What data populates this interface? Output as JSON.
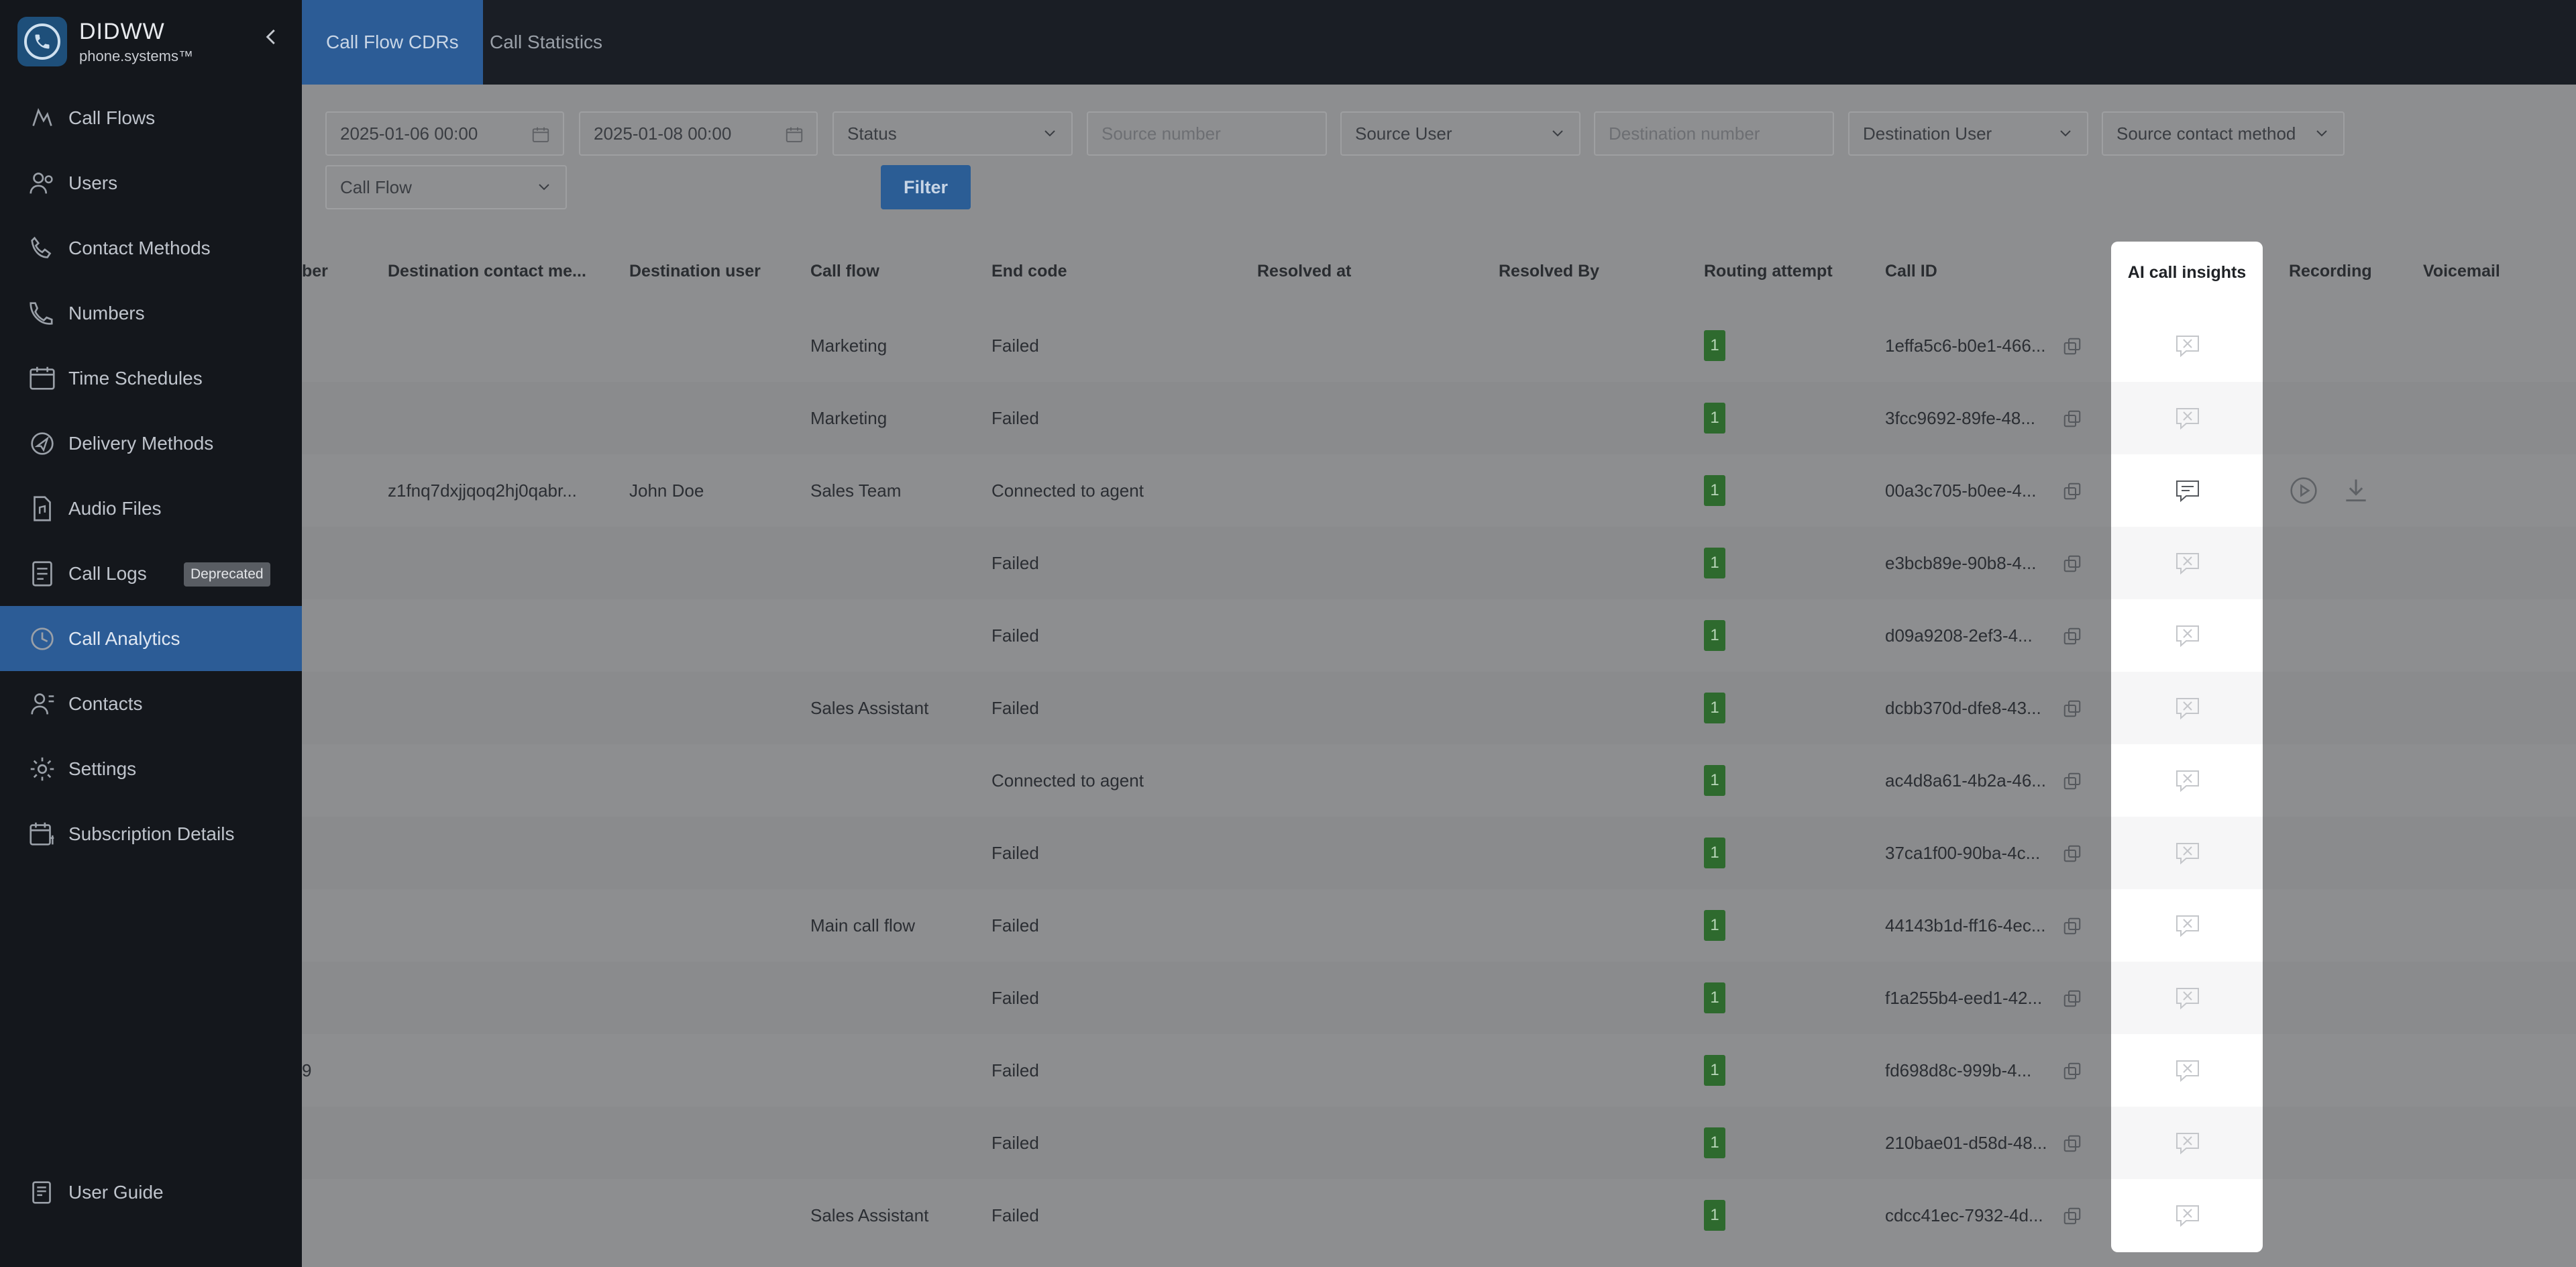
{
  "brand": {
    "name": "DIDWW",
    "subtitle": "phone.systems™"
  },
  "sidebar": {
    "items": [
      {
        "label": "Call Flows",
        "icon": "call-flows-icon"
      },
      {
        "label": "Users",
        "icon": "users-icon"
      },
      {
        "label": "Contact Methods",
        "icon": "contact-methods-icon"
      },
      {
        "label": "Numbers",
        "icon": "numbers-icon"
      },
      {
        "label": "Time Schedules",
        "icon": "calendar-icon"
      },
      {
        "label": "Delivery Methods",
        "icon": "delivery-icon"
      },
      {
        "label": "Audio Files",
        "icon": "audio-file-icon"
      },
      {
        "label": "Call Logs",
        "icon": "document-icon",
        "badge": "Deprecated"
      },
      {
        "label": "Call Analytics",
        "icon": "analytics-icon",
        "active": true
      },
      {
        "label": "Contacts",
        "icon": "contacts-icon"
      },
      {
        "label": "Settings",
        "icon": "gear-icon"
      },
      {
        "label": "Subscription Details",
        "icon": "subscription-icon"
      }
    ],
    "footer": {
      "label": "User Guide",
      "icon": "guide-icon"
    }
  },
  "tabs": [
    {
      "label": "Call Flow CDRs",
      "active": true
    },
    {
      "label": "Call Statistics",
      "active": false
    }
  ],
  "filters": {
    "date_from": "2025-01-06 00:00",
    "date_to": "2025-01-08 00:00",
    "status": "Status",
    "source_number": "Source number",
    "source_user": "Source User",
    "destination_number": "Destination number",
    "destination_user": "Destination User",
    "source_contact_method": "Source contact method",
    "call_flow": "Call Flow",
    "filter_button": "Filter"
  },
  "table": {
    "headers": {
      "number": "ber",
      "destination_contact_method": "Destination contact me...",
      "destination_user": "Destination user",
      "call_flow": "Call flow",
      "end_code": "End code",
      "resolved_at": "Resolved at",
      "resolved_by": "Resolved By",
      "routing_attempt": "Routing attempt",
      "call_id": "Call ID",
      "ai_call_insights": "AI call insights",
      "recording": "Recording",
      "voicemail": "Voicemail"
    },
    "rows": [
      {
        "number": "",
        "dest_contact": "",
        "dest_user": "",
        "call_flow": "Marketing",
        "end_code": "Failed",
        "routing": "1",
        "call_id": "1effa5c6-b0e1-466...",
        "insights": false,
        "recording": false
      },
      {
        "number": "",
        "dest_contact": "",
        "dest_user": "",
        "call_flow": "Marketing",
        "end_code": "Failed",
        "routing": "1",
        "call_id": "3fcc9692-89fe-48...",
        "insights": false,
        "recording": false
      },
      {
        "number": "",
        "dest_contact": "z1fnq7dxjjqoq2hj0qabr...",
        "dest_user": "John Doe",
        "call_flow": "Sales Team",
        "end_code": "Connected to agent",
        "routing": "1",
        "call_id": "00a3c705-b0ee-4...",
        "insights": true,
        "recording": true
      },
      {
        "number": "",
        "dest_contact": "",
        "dest_user": "",
        "call_flow": "",
        "end_code": "Failed",
        "routing": "1",
        "call_id": "e3bcb89e-90b8-4...",
        "insights": false,
        "recording": false
      },
      {
        "number": "",
        "dest_contact": "",
        "dest_user": "",
        "call_flow": "",
        "end_code": "Failed",
        "routing": "1",
        "call_id": "d09a9208-2ef3-4...",
        "insights": false,
        "recording": false
      },
      {
        "number": "",
        "dest_contact": "",
        "dest_user": "",
        "call_flow": "Sales Assistant",
        "end_code": "Failed",
        "routing": "1",
        "call_id": "dcbb370d-dfe8-43...",
        "insights": false,
        "recording": false
      },
      {
        "number": "",
        "dest_contact": "",
        "dest_user": "",
        "call_flow": "",
        "end_code": "Connected to agent",
        "routing": "1",
        "call_id": "ac4d8a61-4b2a-46...",
        "insights": false,
        "recording": false
      },
      {
        "number": "",
        "dest_contact": "",
        "dest_user": "",
        "call_flow": "",
        "end_code": "Failed",
        "routing": "1",
        "call_id": "37ca1f00-90ba-4c...",
        "insights": false,
        "recording": false
      },
      {
        "number": "",
        "dest_contact": "",
        "dest_user": "",
        "call_flow": "Main call flow",
        "end_code": "Failed",
        "routing": "1",
        "call_id": "44143b1d-ff16-4ec...",
        "insights": false,
        "recording": false
      },
      {
        "number": "",
        "dest_contact": "",
        "dest_user": "",
        "call_flow": "",
        "end_code": "Failed",
        "routing": "1",
        "call_id": "f1a255b4-eed1-42...",
        "insights": false,
        "recording": false
      },
      {
        "number": "9",
        "dest_contact": "",
        "dest_user": "",
        "call_flow": "",
        "end_code": "Failed",
        "routing": "1",
        "call_id": "fd698d8c-999b-4...",
        "insights": false,
        "recording": false
      },
      {
        "number": "",
        "dest_contact": "",
        "dest_user": "",
        "call_flow": "",
        "end_code": "Failed",
        "routing": "1",
        "call_id": "210bae01-d58d-48...",
        "insights": false,
        "recording": false
      },
      {
        "number": "",
        "dest_contact": "",
        "dest_user": "",
        "call_flow": "Sales Assistant",
        "end_code": "Failed",
        "routing": "1",
        "call_id": "cdcc41ec-7932-4d...",
        "insights": false,
        "recording": false
      }
    ]
  },
  "colors": {
    "accent": "#2c5c96",
    "sidebar_bg": "#14171c",
    "route_badge": "#2e6a2e"
  }
}
